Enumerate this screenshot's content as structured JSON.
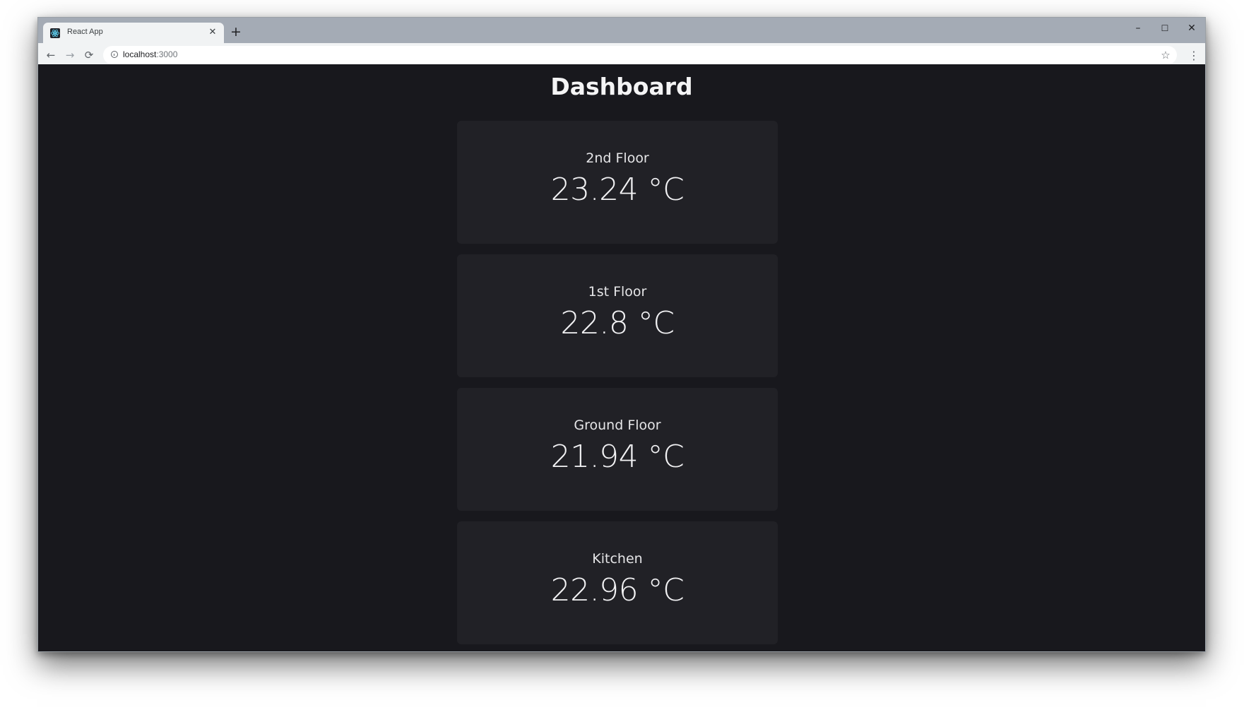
{
  "browser": {
    "tab_title": "React App",
    "tab_close": "✕",
    "new_tab": "+",
    "favicon_icon": "react-logo-icon",
    "url_host": "localhost",
    "url_port": ":3000",
    "window_controls": {
      "minimize": "–",
      "maximize": "☐",
      "close": "✕"
    },
    "nav": {
      "back": "←",
      "forward": "→",
      "reload": "⟳"
    },
    "bookmark_star": "☆",
    "menu_dots": "⋮"
  },
  "dashboard": {
    "title": "Dashboard",
    "cards": [
      {
        "label": "2nd Floor",
        "value": "23.24 °C"
      },
      {
        "label": "1st Floor",
        "value": "22.8 °C"
      },
      {
        "label": "Ground Floor",
        "value": "21.94 °C"
      },
      {
        "label": "Kitchen",
        "value": "22.96 °C"
      }
    ]
  },
  "colors": {
    "page_background": "#18181d",
    "card_background": "#212126",
    "text": "#f2f2f4",
    "tabstrip": "#a4abb5"
  }
}
